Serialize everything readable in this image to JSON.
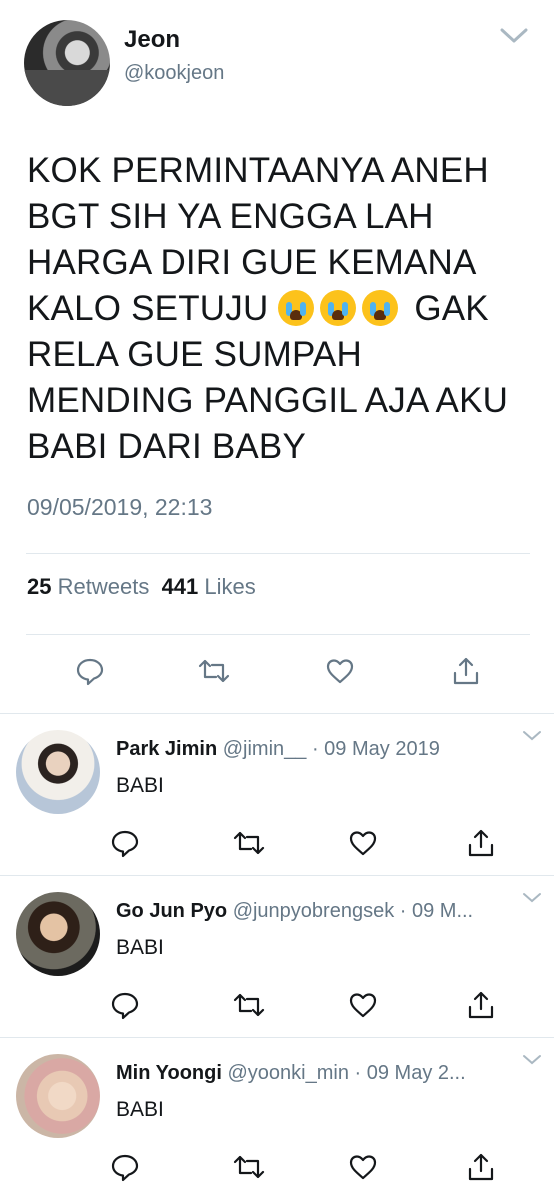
{
  "main": {
    "name": "Jeon",
    "handle": "@kookjeon",
    "text_lines": [
      "KOK PERMINTAANYA ANEH",
      "BGT SIH YA ENGGA LAH",
      "HARGA DIRI GUE KEMANA",
      "KALO SETUJU",
      "GAK",
      "RELA GUE SUMPAH",
      "MENDING PANGGIL AJA AKU",
      "BABI DARI BABY"
    ],
    "emoji_name": "loudly-crying-face",
    "timestamp": "09/05/2019, 22:13",
    "retweets_count": "25",
    "retweets_label": "Retweets",
    "likes_count": "441",
    "likes_label": "Likes"
  },
  "replies": [
    {
      "name": "Park Jimin",
      "handle": "@jimin__",
      "date": "· 09 May 2019",
      "text": "BABI"
    },
    {
      "name": "Go Jun Pyo",
      "handle": "@junpyobrengsek",
      "date": "· 09 M...",
      "text": "BABI"
    },
    {
      "name": "Min Yoongi",
      "handle": "@yoonki_min",
      "date": "· 09 May 2...",
      "text": "BABI"
    }
  ],
  "icons": [
    "reply-icon",
    "retweet-icon",
    "like-icon",
    "share-icon",
    "chevron-down-icon"
  ],
  "colors": {
    "text": "#14171a",
    "secondary": "#657786",
    "divider": "#e1e8ed",
    "icon": "#657786"
  }
}
